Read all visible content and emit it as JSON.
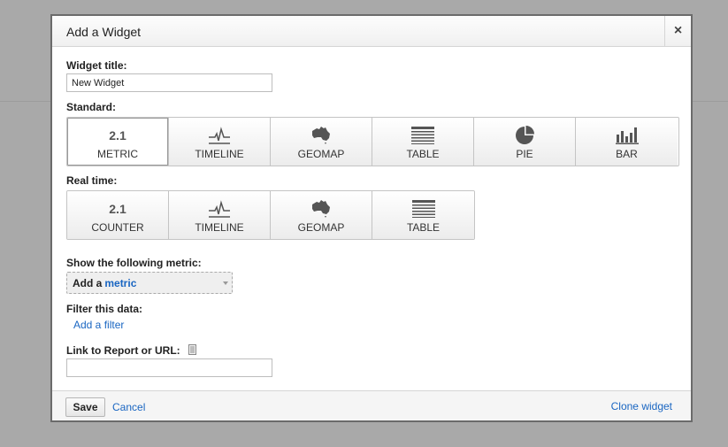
{
  "dialog": {
    "title": "Add a Widget",
    "close_label": "×"
  },
  "widget_title": {
    "label": "Widget title:",
    "value": "New Widget"
  },
  "standard": {
    "label": "Standard:",
    "buttons": [
      {
        "label": "METRIC",
        "number": "2.1",
        "icon": "metric-icon",
        "selected": true
      },
      {
        "label": "TIMELINE",
        "icon": "timeline-icon"
      },
      {
        "label": "GEOMAP",
        "icon": "geomap-icon"
      },
      {
        "label": "TABLE",
        "icon": "table-icon"
      },
      {
        "label": "PIE",
        "icon": "pie-icon"
      },
      {
        "label": "BAR",
        "icon": "bar-icon"
      }
    ]
  },
  "realtime": {
    "label": "Real time:",
    "buttons": [
      {
        "label": "COUNTER",
        "number": "2.1",
        "icon": "counter-icon"
      },
      {
        "label": "TIMELINE",
        "icon": "timeline-icon"
      },
      {
        "label": "GEOMAP",
        "icon": "geomap-icon"
      },
      {
        "label": "TABLE",
        "icon": "table-icon"
      }
    ]
  },
  "metric": {
    "label": "Show the following metric:",
    "prefix": "Add a",
    "link": "metric"
  },
  "filter": {
    "label": "Filter this data:",
    "link": "Add a filter"
  },
  "link_report": {
    "label": "Link to Report or URL:",
    "value": ""
  },
  "footer": {
    "save": "Save",
    "cancel": "Cancel",
    "clone": "Clone widget"
  },
  "colors": {
    "link": "#1a66c2",
    "overlay": "#a9a9a9"
  }
}
